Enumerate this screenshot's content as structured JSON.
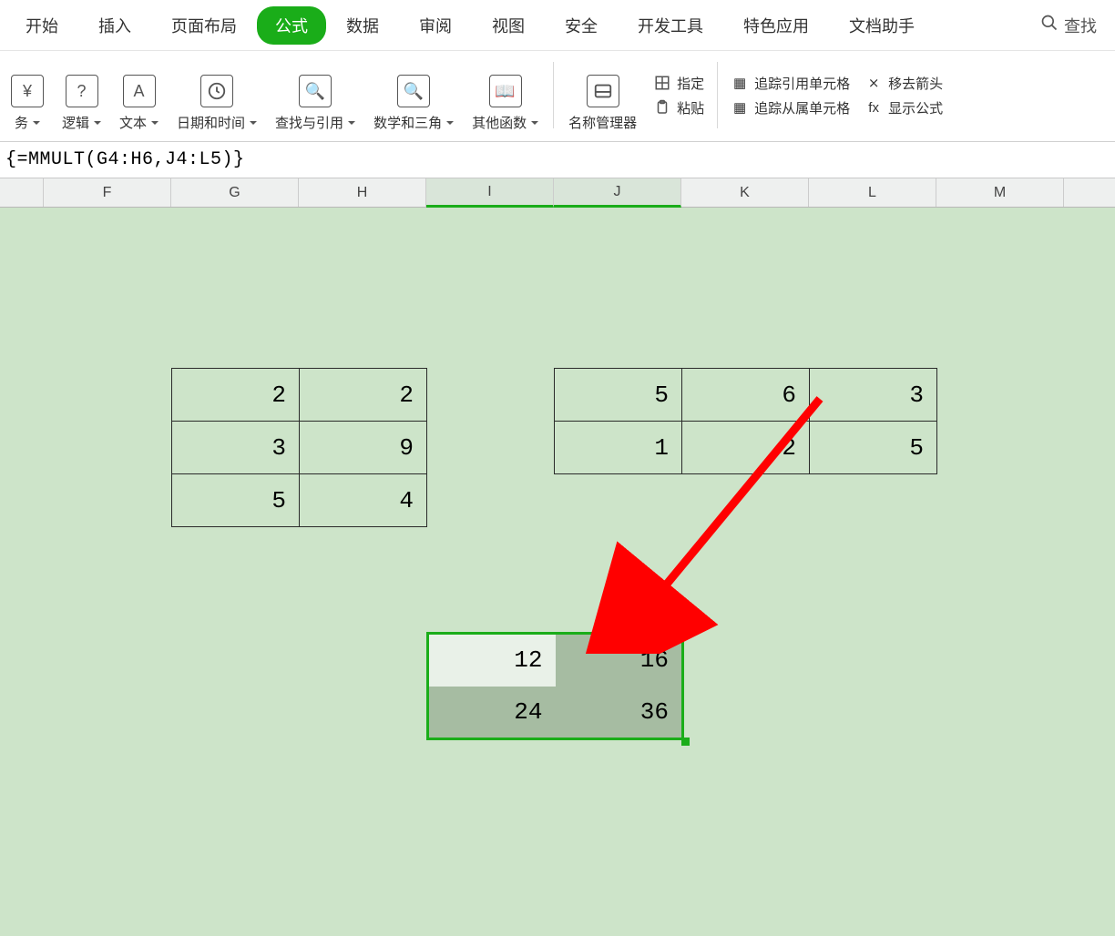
{
  "tabs": {
    "items": [
      "开始",
      "插入",
      "页面布局",
      "公式",
      "数据",
      "审阅",
      "视图",
      "安全",
      "开发工具",
      "特色应用",
      "文档助手"
    ],
    "active_index": 3,
    "search_label": "查找"
  },
  "ribbon": {
    "finance": "务",
    "logic": "逻辑",
    "text": "文本",
    "datetime": "日期和时间",
    "lookup": "查找与引用",
    "math": "数学和三角",
    "other": "其他函数",
    "name_mgr": "名称管理器",
    "assign": "指定",
    "paste": "粘贴",
    "trace_ref": "追踪引用单元格",
    "trace_dep": "追踪从属单元格",
    "remove_arrows": "移去箭头",
    "show_formula": "显示公式",
    "icon_finance": "¥",
    "icon_logic": "?",
    "icon_text": "A",
    "icon_lookup": "🔍",
    "icon_math": "🔍",
    "icon_other": "📖"
  },
  "formula": {
    "text": "{=MMULT(G4:H6,J4:L5)}"
  },
  "columns": [
    "F",
    "G",
    "H",
    "I",
    "J",
    "K",
    "L",
    "M"
  ],
  "columns_selected": [
    3,
    4
  ],
  "matrix_a": [
    [
      2,
      2
    ],
    [
      3,
      9
    ],
    [
      5,
      4
    ]
  ],
  "matrix_b": [
    [
      5,
      6,
      3
    ],
    [
      1,
      2,
      5
    ]
  ],
  "result": [
    [
      12,
      16
    ],
    [
      24,
      36
    ]
  ],
  "colors": {
    "accent": "#1aad19",
    "sheet_bg": "#cde4c9"
  }
}
